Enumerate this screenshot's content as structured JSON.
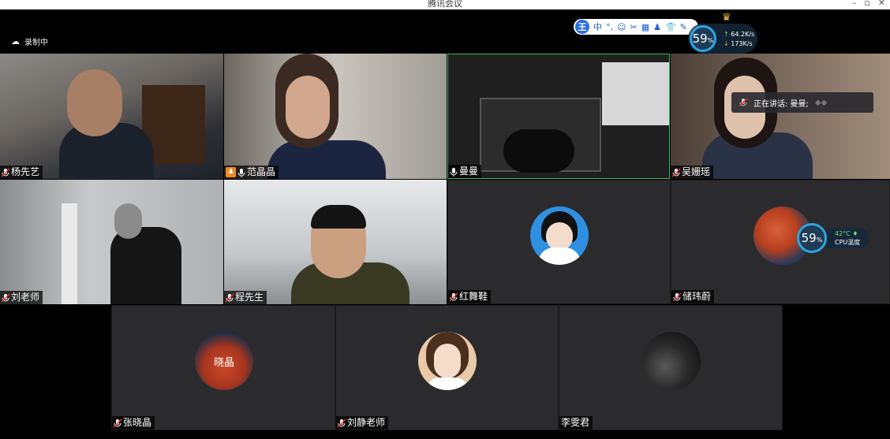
{
  "window": {
    "title": "腾讯会议",
    "controls": [
      "–",
      "▫",
      "✕"
    ]
  },
  "recording": {
    "label": "录制中",
    "icon": "cloud-icon"
  },
  "ime": {
    "logo": "王",
    "items": [
      "中",
      "°,",
      "☺",
      "✂",
      "▦",
      "♟",
      "👕",
      "✎"
    ]
  },
  "net_speed": {
    "percent": "59",
    "unit": "%",
    "up": "64.2K/s",
    "down": "173K/s"
  },
  "speaking": {
    "label": "正在讲话: 曼曼;"
  },
  "cpu_widget": {
    "percent": "59",
    "unit": "%",
    "temp": "42°C",
    "label": "CPU温度"
  },
  "participants": [
    {
      "name": "杨先艺",
      "mic": "muted"
    },
    {
      "name": "范晶晶",
      "mic": "on",
      "host": true
    },
    {
      "name": "曼曼",
      "mic": "on"
    },
    {
      "name": "吴姗瑶",
      "mic": "muted"
    },
    {
      "name": "刘老师",
      "mic": "muted"
    },
    {
      "name": "程先生",
      "mic": "muted"
    },
    {
      "name": "红舞鞋",
      "mic": "muted"
    },
    {
      "name": "储玮蔚",
      "mic": "muted"
    },
    {
      "name": "张晓晶",
      "mic": "muted",
      "avatar_text": "晓晶"
    },
    {
      "name": "刘静老师",
      "mic": "muted"
    },
    {
      "name": "李雯君",
      "mic": "none"
    }
  ]
}
